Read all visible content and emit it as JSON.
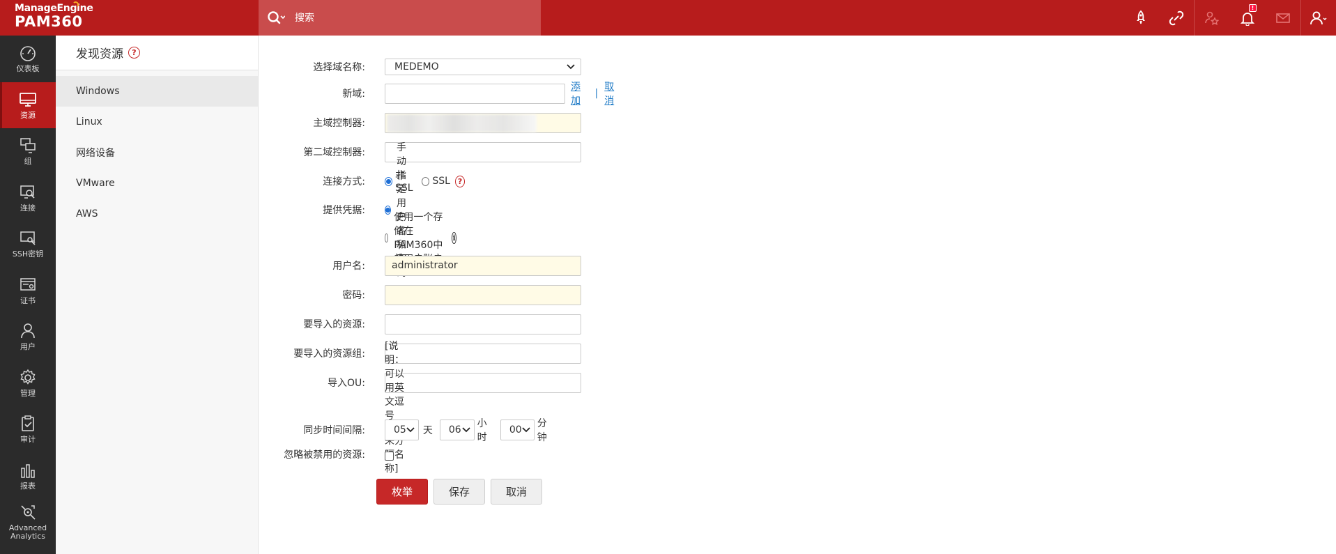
{
  "brand": {
    "company": "ManageEngine",
    "product": "PAM360"
  },
  "search": {
    "placeholder": "搜索"
  },
  "top_icons": [
    "rocket-icon",
    "link-icon",
    "star-user-icon",
    "bell-icon",
    "mail-icon",
    "user-icon"
  ],
  "notifications": {
    "badge": "!"
  },
  "sidebar": {
    "items": [
      {
        "label": "仪表板",
        "icon": "dashboard-icon"
      },
      {
        "label": "资源",
        "icon": "monitor-icon"
      },
      {
        "label": "组",
        "icon": "group-icon"
      },
      {
        "label": "连接",
        "icon": "connection-icon"
      },
      {
        "label": "SSH密钥",
        "icon": "ssh-key-icon"
      },
      {
        "label": "证书",
        "icon": "certificate-icon"
      },
      {
        "label": "用户",
        "icon": "user-icon"
      },
      {
        "label": "管理",
        "icon": "gear-icon"
      },
      {
        "label": "审计",
        "icon": "audit-icon"
      },
      {
        "label": "报表",
        "icon": "report-icon"
      },
      {
        "label": "Advanced Analytics",
        "icon": "analytics-icon"
      }
    ]
  },
  "subpanel": {
    "title": "发现资源",
    "help": "?",
    "items": [
      "Windows",
      "Linux",
      "网络设备",
      "VMware",
      "AWS"
    ]
  },
  "form": {
    "domain_label": "选择域名称:",
    "domain_value": "MEDEMO",
    "new_domain_label": "新域:",
    "add_link": "添加",
    "link_separator": "|",
    "cancel_link": "取消",
    "primary_dc_label": "主域控制器:",
    "secondary_dc_label": "第二域控制器:",
    "connection_label": "连接方式:",
    "non_ssl": "非SSL",
    "ssl": "SSL",
    "connection_help": "?",
    "credentials_label": "提供凭据:",
    "manual_option": "手动指定用户名和密码",
    "stored_option": "使用一个存储在PAM360中的用户账户",
    "stored_info": "i",
    "username_label": "用户名:",
    "username_value": "administrator",
    "password_label": "密码:",
    "import_resources_label": "要导入的资源:",
    "import_groups_label": "要导入的资源组:",
    "import_ou_label": "导入OU:",
    "note": "[说明：可以用英文逗号(',')来分隔名称]",
    "sync_label": "同步时间间隔:",
    "sync_days": "05",
    "days_unit": "天",
    "sync_hours": "06",
    "hours_unit": "小时",
    "sync_minutes": "00",
    "minutes_unit": "分钟",
    "ignore_disabled_label": "忽略被禁用的资源:"
  },
  "buttons": {
    "enumerate": "枚举",
    "save": "保存",
    "cancel": "取消"
  },
  "colors": {
    "brand_red": "#b71c1c",
    "sidebar_bg": "#2b2b2b",
    "link_blue": "#1e7ac6"
  }
}
